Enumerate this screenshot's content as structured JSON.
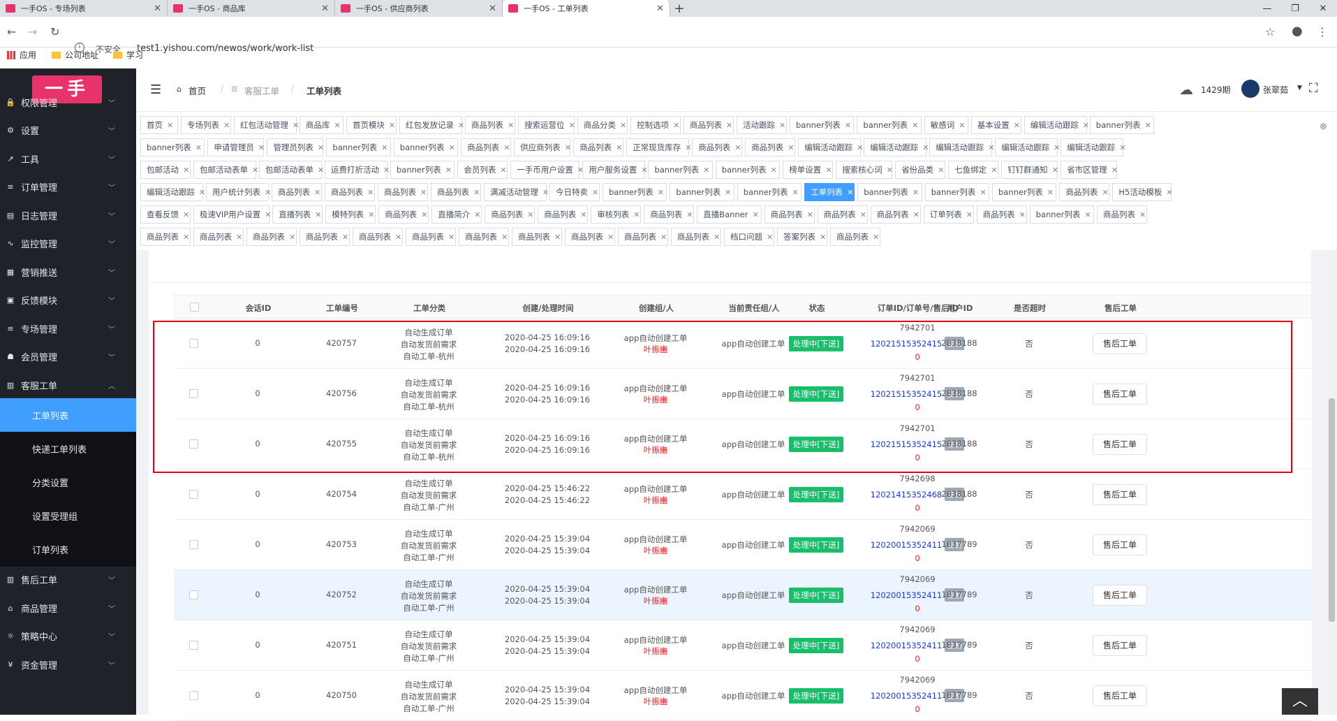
{
  "browser": {
    "tabs": [
      {
        "title": "一手OS - 专场列表"
      },
      {
        "title": "一手OS - 商品库"
      },
      {
        "title": "一手OS - 供应商列表"
      },
      {
        "title": "一手OS - 工单列表"
      }
    ],
    "new_tab": "+",
    "insecure": "不安全",
    "url": "test1.yishou.com/newos/work/work-list",
    "bookmarks": [
      "应用",
      "公司地址",
      "学习"
    ]
  },
  "logo": "一手",
  "sidebar": {
    "menus": [
      {
        "label": "权限管理",
        "icon": "lock-icon",
        "glyph": "🔒"
      },
      {
        "label": "设置",
        "icon": "gear-icon",
        "glyph": "⚙"
      },
      {
        "label": "工具",
        "icon": "wrench-icon",
        "glyph": "↗"
      },
      {
        "label": "订单管理",
        "icon": "list-icon",
        "glyph": "≡"
      },
      {
        "label": "日志管理",
        "icon": "log-icon",
        "glyph": "▤"
      },
      {
        "label": "监控管理",
        "icon": "pulse-icon",
        "glyph": "∿"
      },
      {
        "label": "营销推送",
        "icon": "push-icon",
        "glyph": "▦"
      },
      {
        "label": "反馈模块",
        "icon": "image-icon",
        "glyph": "▣"
      },
      {
        "label": "专场管理",
        "icon": "list-icon",
        "glyph": "≡"
      },
      {
        "label": "会员管理",
        "icon": "member-icon",
        "glyph": "☗"
      },
      {
        "label": "客服工单",
        "icon": "ticket-icon",
        "glyph": "▥"
      }
    ],
    "submenus": [
      "工单列表",
      "快递工单列表",
      "分类设置",
      "设置受理组",
      "订单列表"
    ],
    "menus_after": [
      {
        "label": "售后工单",
        "icon": "ticket-icon",
        "glyph": "▥"
      },
      {
        "label": "商品管理",
        "icon": "shirt-icon",
        "glyph": "⌂"
      },
      {
        "label": "策略中心",
        "icon": "bulb-icon",
        "glyph": "☼"
      },
      {
        "label": "资金管理",
        "icon": "yen-icon",
        "glyph": "¥"
      }
    ]
  },
  "breadcrumb": {
    "home": "首页",
    "parent": "客服工单",
    "current": "工单列表"
  },
  "header": {
    "period": "1429期",
    "user": "张翠茹"
  },
  "tags": {
    "row1": [
      "首页",
      "专场列表",
      "红包活动管理",
      "商品库",
      "首页模块",
      "红包发放记录",
      "商品列表",
      "搜索运营位",
      "商品分类",
      "控制选项",
      "商品列表",
      "活动跟踪",
      "banner列表",
      "banner列表",
      "敏感词",
      "基本设置",
      "编辑活动跟踪",
      "banner列表"
    ],
    "row2": [
      "banner列表",
      "申请管理员",
      "管理员列表",
      "banner列表",
      "banner列表",
      "商品列表",
      "供应商列表",
      "商品列表",
      "正常现货库存",
      "商品列表",
      "商品列表",
      "编辑活动跟踪",
      "编辑活动跟踪",
      "编辑活动跟踪",
      "编辑活动跟踪",
      "编辑活动跟踪"
    ],
    "row3": [
      "包邮活动",
      "包邮活动表单",
      "包邮活动表单",
      "运费打折活动",
      "banner列表",
      "会员列表",
      "一手币用户设置",
      "用户服务设置",
      "banner列表",
      "banner列表",
      "榜单设置",
      "搜索核心词",
      "省份品类",
      "七鱼绑定",
      "钉钉群通知",
      "省市区管理"
    ],
    "row4": [
      "编辑活动跟踪",
      "用户统计列表",
      "商品列表",
      "商品列表",
      "商品列表",
      "商品列表",
      "满减活动管理",
      "今日特卖",
      "banner列表",
      "banner列表",
      "banner列表",
      "工单列表",
      "banner列表",
      "banner列表",
      "banner列表",
      "商品列表",
      "H5活动模板"
    ],
    "row5": [
      "查看反馈",
      "极速VIP用户设置",
      "直播列表",
      "模特列表",
      "商品列表",
      "直播简介",
      "商品列表",
      "商品列表",
      "审核列表",
      "商品列表",
      "直播Banner",
      "商品列表",
      "商品列表",
      "商品列表",
      "订单列表",
      "商品列表",
      "banner列表",
      "商品列表"
    ],
    "row6": [
      "商品列表",
      "商品列表",
      "商品列表",
      "商品列表",
      "商品列表",
      "商品列表",
      "商品列表",
      "商品列表",
      "商品列表",
      "商品列表",
      "商品列表",
      "档口问题",
      "答案列表",
      "商品列表"
    ]
  },
  "table": {
    "columns": [
      "会话ID",
      "工单编号",
      "工单分类",
      "创建/处理时间",
      "创建组/人",
      "当前责任组/人",
      "状态",
      "订单ID/订单号/售后ID",
      "用户ID",
      "是否超时",
      "售后工单"
    ],
    "rows": [
      {
        "session": "0",
        "no": "420757",
        "cat": [
          "自动生成订单",
          "自动发货前需求",
          "自动工单-杭州"
        ],
        "t1": "2020-04-25 16:09:16",
        "t2": "2020-04-25 16:09:16",
        "creator": "app自动创建工单",
        "person": "叶振豳",
        "owner": "app自动创建工单",
        "status": "处理中[下送]",
        "order": "7942701",
        "orderno": "12021515352415",
        "copy": "复制",
        "after": "0",
        "uid": "2838188",
        "timeout": "否",
        "btn": "售后工单"
      },
      {
        "session": "0",
        "no": "420756",
        "cat": [
          "自动生成订单",
          "自动发货前需求",
          "自动工单-杭州"
        ],
        "t1": "2020-04-25 16:09:16",
        "t2": "2020-04-25 16:09:16",
        "creator": "app自动创建工单",
        "person": "叶振豳",
        "owner": "app自动创建工单",
        "status": "处理中[下送]",
        "order": "7942701",
        "orderno": "12021515352415",
        "copy": "复制",
        "after": "0",
        "uid": "2838188",
        "timeout": "否",
        "btn": "售后工单"
      },
      {
        "session": "0",
        "no": "420755",
        "cat": [
          "自动生成订单",
          "自动发货前需求",
          "自动工单-杭州"
        ],
        "t1": "2020-04-25 16:09:16",
        "t2": "2020-04-25 16:09:16",
        "creator": "app自动创建工单",
        "person": "叶振豳",
        "owner": "app自动创建工单",
        "status": "处理中[下送]",
        "order": "7942701",
        "orderno": "12021515352415",
        "copy": "复制",
        "after": "0",
        "uid": "2838188",
        "timeout": "否",
        "btn": "售后工单"
      },
      {
        "session": "0",
        "no": "420754",
        "cat": [
          "自动生成订单",
          "自动发货前需求",
          "自动工单-广州"
        ],
        "t1": "2020-04-25 15:46:22",
        "t2": "2020-04-25 15:46:22",
        "creator": "app自动创建工单",
        "person": "叶振豳",
        "owner": "app自动创建工单",
        "status": "处理中[下送]",
        "order": "7942698",
        "orderno": "12021415352468",
        "copy": "复制",
        "after": "0",
        "uid": "2838188",
        "timeout": "否",
        "btn": "售后工单"
      },
      {
        "session": "0",
        "no": "420753",
        "cat": [
          "自动生成订单",
          "自动发货前需求",
          "自动工单-广州"
        ],
        "t1": "2020-04-25 15:39:04",
        "t2": "2020-04-25 15:39:04",
        "creator": "app自动创建工单",
        "person": "叶振豳",
        "owner": "app自动创建工单",
        "status": "处理中[下送]",
        "order": "7942069",
        "orderno": "12020015352411",
        "copy": "复制",
        "after": "0",
        "uid": "1837789",
        "timeout": "否",
        "btn": "售后工单"
      },
      {
        "session": "0",
        "no": "420752",
        "cat": [
          "自动生成订单",
          "自动发货前需求",
          "自动工单-广州"
        ],
        "t1": "2020-04-25 15:39:04",
        "t2": "2020-04-25 15:39:04",
        "creator": "app自动创建工单",
        "person": "叶振豳",
        "owner": "app自动创建工单",
        "status": "处理中[下送]",
        "order": "7942069",
        "orderno": "12020015352411",
        "copy": "复制",
        "after": "0",
        "uid": "1837789",
        "timeout": "否",
        "btn": "售后工单"
      },
      {
        "session": "0",
        "no": "420751",
        "cat": [
          "自动生成订单",
          "自动发货前需求",
          "自动工单-广州"
        ],
        "t1": "2020-04-25 15:39:04",
        "t2": "2020-04-25 15:39:04",
        "creator": "app自动创建工单",
        "person": "叶振豳",
        "owner": "app自动创建工单",
        "status": "处理中[下送]",
        "order": "7942069",
        "orderno": "12020015352411",
        "copy": "复制",
        "after": "0",
        "uid": "1837789",
        "timeout": "否",
        "btn": "售后工单"
      },
      {
        "session": "0",
        "no": "420750",
        "cat": [
          "自动生成订单",
          "自动发货前需求",
          "自动工单-广州"
        ],
        "t1": "2020-04-25 15:39:04",
        "t2": "2020-04-25 15:39:04",
        "creator": "app自动创建工单",
        "person": "叶振豳",
        "owner": "app自动创建工单",
        "status": "处理中[下送]",
        "order": "7942069",
        "orderno": "12020015352411",
        "copy": "复制",
        "after": "0",
        "uid": "1837789",
        "timeout": "否",
        "btn": "售后工单"
      }
    ],
    "highlighted_row": 5
  }
}
